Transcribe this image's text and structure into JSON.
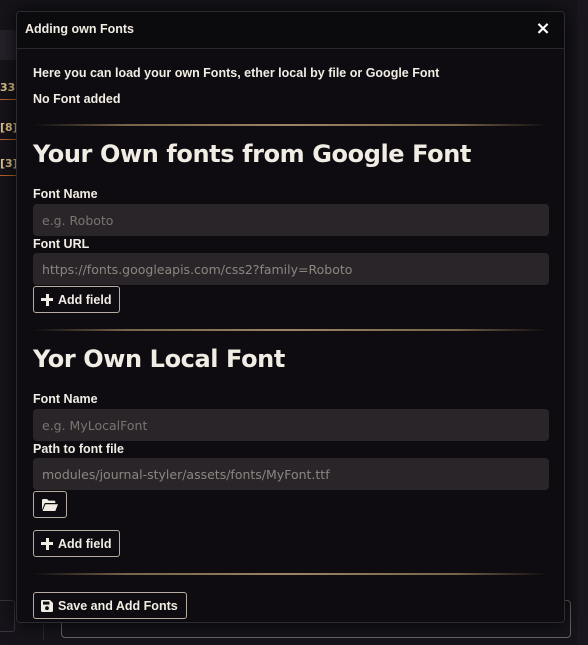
{
  "background": {
    "badges": [
      "33]",
      "[8]",
      "[3]"
    ]
  },
  "dialog": {
    "title": "Adding own Fonts",
    "close_glyph": "×",
    "intro": "Here you can load your own Fonts, ether local by file or Google Font",
    "status": "No Font added",
    "google_section": {
      "title": "Your Own fonts from Google Font",
      "font_name_label": "Font Name",
      "font_name_placeholder": "e.g. Roboto",
      "font_url_label": "Font URL",
      "font_url_placeholder": "https://fonts.googleapis.com/css2?family=Roboto",
      "add_field_label": "Add field"
    },
    "local_section": {
      "title": "Yor Own Local Font",
      "font_name_label": "Font Name",
      "font_name_placeholder": "e.g. MyLocalFont",
      "path_label": "Path to font file",
      "path_placeholder": "modules/journal-styler/assets/fonts/MyFont.ttf",
      "add_field_label": "Add field"
    },
    "save_button_label": "Save and Add Fonts"
  },
  "icons": {
    "close": "close-icon",
    "plus": "plus-icon",
    "folder": "folder-open-icon",
    "save": "floppy-disk-icon"
  },
  "colors": {
    "dialog_bg": "#0e0c10",
    "text": "#f1ece4",
    "input_bg": "#2a2529",
    "divider": "#b49a73",
    "badge_text": "#e6c68a",
    "badge_border": "#b9632a"
  }
}
